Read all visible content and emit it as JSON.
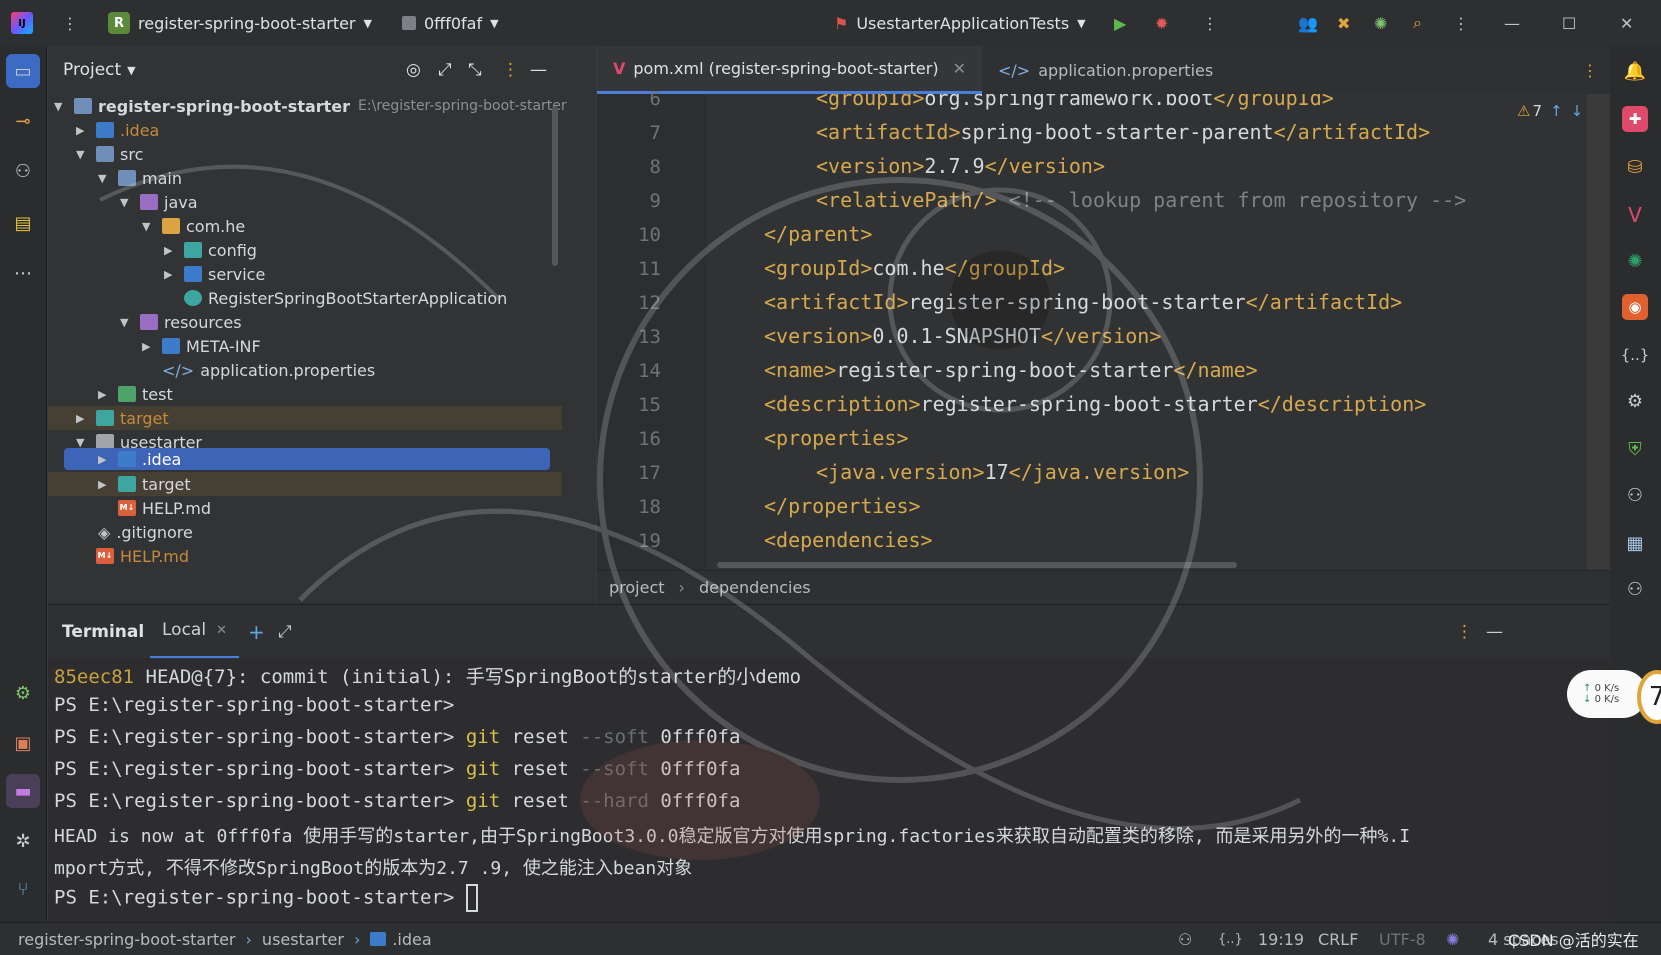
{
  "titlebar": {
    "project_badge": "R",
    "project_name": "register-spring-boot-starter",
    "commit": "0fff0faf",
    "run_config": "UsestarterApplicationTests"
  },
  "project_panel": {
    "title": "Project",
    "root_name": "register-spring-boot-starter",
    "root_path": "E:\\register-spring-boot-starter",
    "tree": [
      {
        "label": ".idea"
      },
      {
        "label": "src"
      },
      {
        "label": "main"
      },
      {
        "label": "java"
      },
      {
        "label": "com.he"
      },
      {
        "label": "config"
      },
      {
        "label": "service"
      },
      {
        "label": "RegisterSpringBootStarterApplication"
      },
      {
        "label": "resources"
      },
      {
        "label": "META-INF"
      },
      {
        "label": "application.properties"
      },
      {
        "label": "test"
      },
      {
        "label": "target"
      },
      {
        "label": "usestarter"
      },
      {
        "label": ".idea"
      },
      {
        "label": "target"
      },
      {
        "label": "HELP.md"
      },
      {
        "label": ".gitignore"
      },
      {
        "label": "HELP.md"
      }
    ]
  },
  "editor": {
    "tabs": [
      {
        "label": "pom.xml (register-spring-boot-starter)"
      },
      {
        "label": "application.properties"
      }
    ],
    "warnings": "7",
    "line_numbers": [
      "6",
      "7",
      "8",
      "9",
      "10",
      "11",
      "12",
      "13",
      "14",
      "15",
      "16",
      "17",
      "18",
      "19"
    ],
    "lines": [
      {
        "tag_open": "<groupId>",
        "text": "org.springframework.boot",
        "tag_close": "</groupId>"
      },
      {
        "tag_open": "<artifactId>",
        "text": "spring-boot-starter-parent",
        "tag_close": "</artifactId>"
      },
      {
        "tag_open": "<version>",
        "text": "2.7.9",
        "tag_close": "</version>"
      },
      {
        "tag_open": "<relativePath/>",
        "text": "",
        "comment": " <!-- lookup parent from repository -->"
      },
      {
        "tag_open": "</parent>",
        "text": "",
        "tag_close": ""
      },
      {
        "tag_open": "<groupId>",
        "text": "com.he",
        "tag_close": "</groupId>"
      },
      {
        "tag_open": "<artifactId>",
        "text": "register-spring-boot-starter",
        "tag_close": "</artifactId>"
      },
      {
        "tag_open": "<version>",
        "text": "0.0.1-SNAPSHOT",
        "tag_close": "</version>"
      },
      {
        "tag_open": "<name>",
        "text": "register-spring-boot-starter",
        "tag_close": "</name>"
      },
      {
        "tag_open": "<description>",
        "text": "register-spring-boot-starter",
        "tag_close": "</description>"
      },
      {
        "tag_open": "<properties>",
        "text": "",
        "tag_close": ""
      },
      {
        "tag_open": "<java.version>",
        "text": "17",
        "tag_close": "</java.version>"
      },
      {
        "tag_open": "</properties>",
        "text": "",
        "tag_close": ""
      },
      {
        "tag_open": "<dependencies>",
        "text": "",
        "tag_close": ""
      }
    ],
    "breadcrumb": [
      "project",
      "dependencies"
    ]
  },
  "terminal": {
    "title": "Terminal",
    "tab": "Local",
    "lines": [
      {
        "hash": "85eec81",
        "rest": " HEAD@{7}: commit (initial): 手写SpringBoot的starter的小demo"
      },
      {
        "prompt": "PS E:\\register-spring-boot-starter>"
      },
      {
        "prompt": "PS E:\\register-spring-boot-starter>",
        "cmd": "git",
        "args1": "reset",
        "flag": "--soft",
        "args2": "0fff0fa"
      },
      {
        "prompt": "PS E:\\register-spring-boot-starter>",
        "cmd": "git",
        "args1": "reset",
        "flag": "--soft",
        "args2": "0fff0fa"
      },
      {
        "prompt": "PS E:\\register-spring-boot-starter>",
        "cmd": "git",
        "args1": "reset",
        "flag": "--hard",
        "args2": "0fff0fa"
      },
      {
        "text": "HEAD is now at 0fff0fa 使用手写的starter,由于SpringBoot3.0.0稳定版官方对使用spring.factories来获取自动配置类的移除, 而是采用另外的一种%.I"
      },
      {
        "text": "mport方式, 不得不修改SpringBoot的版本为2.7 .9, 使之能注入bean对象"
      },
      {
        "prompt": "PS E:\\register-spring-boot-starter>"
      }
    ]
  },
  "statusbar": {
    "crumbs": [
      "register-spring-boot-starter",
      "usestarter",
      ".idea"
    ],
    "position": "19:19",
    "line_sep": "CRLF",
    "encoding": "UTF-8",
    "indent": "4 spaces",
    "watermark": "CSDN @活的实在"
  },
  "net_widget": {
    "up": "0  K/s",
    "down": "0  K/s"
  },
  "badge": "7"
}
